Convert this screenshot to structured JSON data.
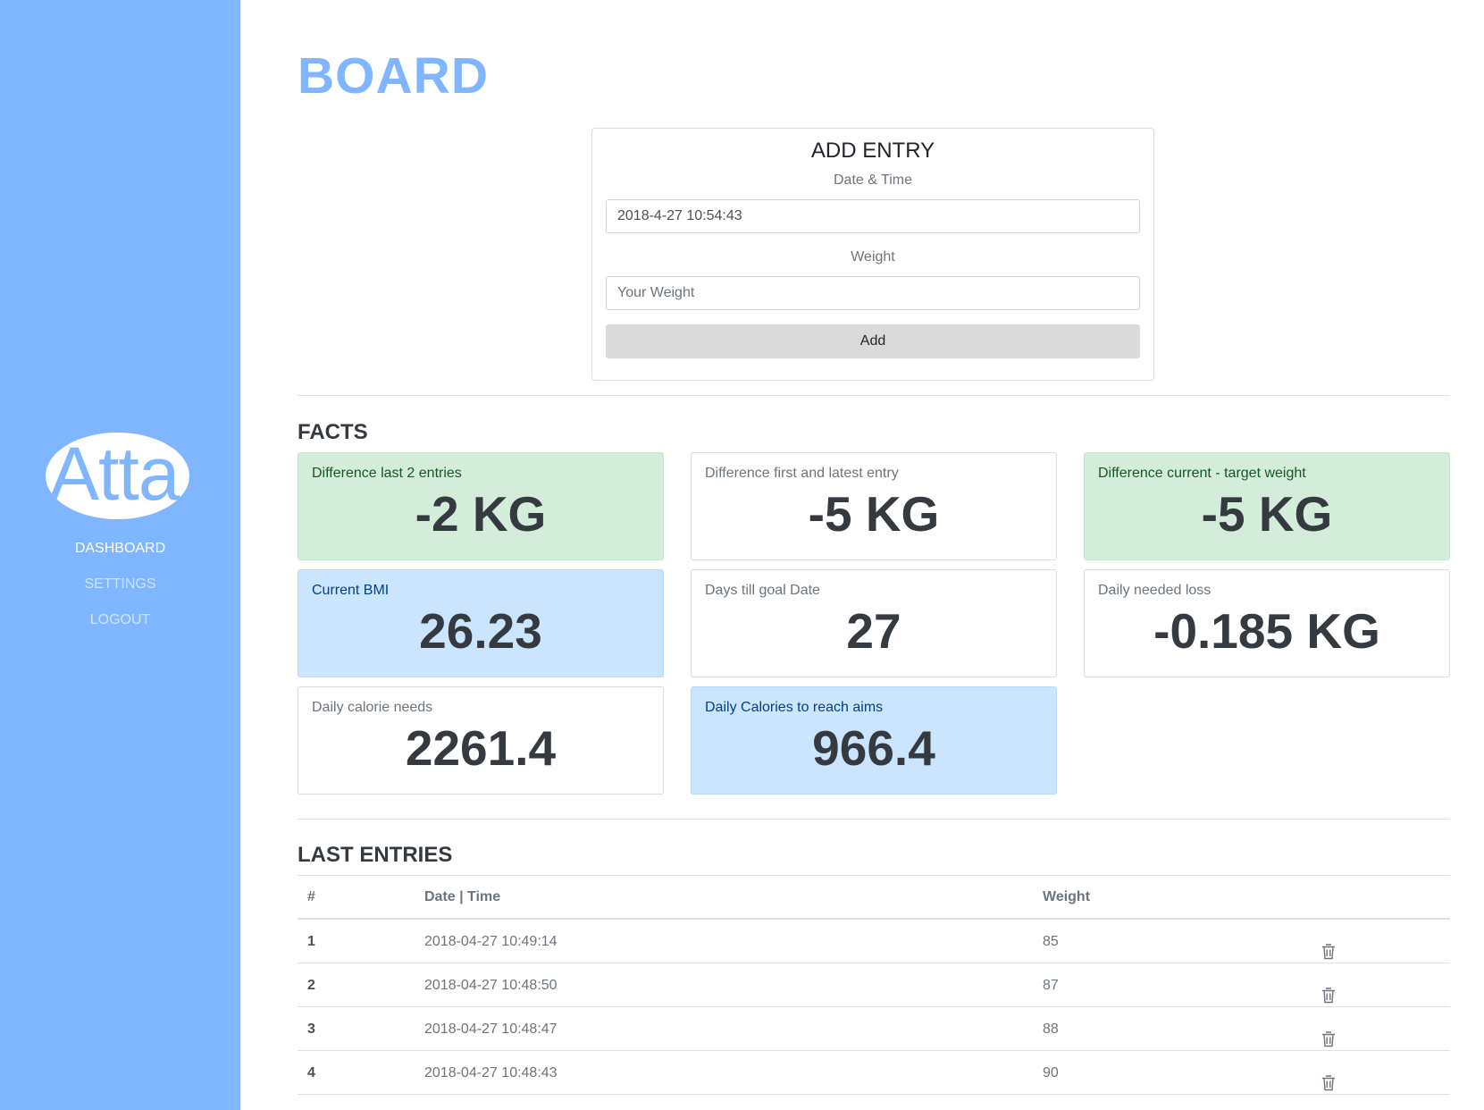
{
  "sidebar": {
    "logo_text": "Atta",
    "nav": [
      {
        "label": "DASHBOARD",
        "active": true
      },
      {
        "label": "SETTINGS",
        "active": false
      },
      {
        "label": "LOGOUT",
        "active": false
      }
    ]
  },
  "page_title": "BOARD",
  "add_entry": {
    "title": "ADD ENTRY",
    "datetime_label": "Date & Time",
    "datetime_value": "2018-4-27 10:54:43",
    "weight_label": "Weight",
    "weight_placeholder": "Your Weight",
    "add_label": "Add"
  },
  "facts": {
    "title": "FACTS",
    "items": [
      {
        "label": "Difference last 2 entries",
        "value": "-2 KG",
        "style": "green"
      },
      {
        "label": "Difference first and latest entry",
        "value": "-5 KG",
        "style": "plain"
      },
      {
        "label": "Difference current - target weight",
        "value": "-5 KG",
        "style": "green"
      },
      {
        "label": "Current BMI",
        "value": "26.23",
        "style": "blue"
      },
      {
        "label": "Days till goal Date",
        "value": "27",
        "style": "plain"
      },
      {
        "label": "Daily needed loss",
        "value": "-0.185 KG",
        "style": "plain"
      },
      {
        "label": "Daily calorie needs",
        "value": "2261.4",
        "style": "plain"
      },
      {
        "label": "Daily Calories to reach aims",
        "value": "966.4",
        "style": "blue"
      }
    ]
  },
  "entries": {
    "title": "LAST ENTRIES",
    "columns": [
      "#",
      "Date | Time",
      "Weight"
    ],
    "rows": [
      {
        "num": "1",
        "datetime": "2018-04-27 10:49:14",
        "weight": "85"
      },
      {
        "num": "2",
        "datetime": "2018-04-27 10:48:50",
        "weight": "87"
      },
      {
        "num": "3",
        "datetime": "2018-04-27 10:48:47",
        "weight": "88"
      },
      {
        "num": "4",
        "datetime": "2018-04-27 10:48:43",
        "weight": "90"
      }
    ],
    "delete_icon": "trash-icon"
  },
  "colors": {
    "sidebar": "#80b6ff",
    "title": "#80b6ff",
    "green_card": "#d4edda",
    "blue_card": "#cce5ff"
  }
}
